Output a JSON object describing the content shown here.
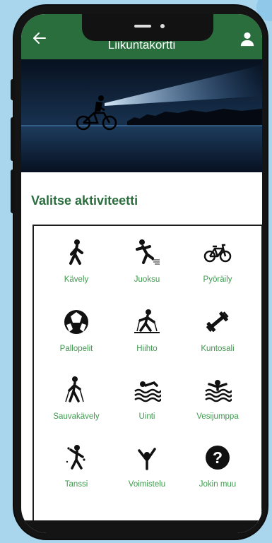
{
  "header": {
    "title": "Liikuntakortti"
  },
  "section": {
    "title": "Valitse aktiviteetti"
  },
  "activities": [
    {
      "label": "Kävely",
      "icon": "walking-icon"
    },
    {
      "label": "Juoksu",
      "icon": "running-icon"
    },
    {
      "label": "Pyöräily",
      "icon": "bicycle-icon"
    },
    {
      "label": "Pallopelit",
      "icon": "ball-games-icon"
    },
    {
      "label": "Hiihto",
      "icon": "skiing-icon"
    },
    {
      "label": "Kuntosali",
      "icon": "dumbbell-icon"
    },
    {
      "label": "Sauvakävely",
      "icon": "nordic-walking-icon"
    },
    {
      "label": "Uinti",
      "icon": "swimming-icon"
    },
    {
      "label": "Vesijumppa",
      "icon": "water-aerobics-icon"
    },
    {
      "label": "Tanssi",
      "icon": "dance-icon"
    },
    {
      "label": "Voimistelu",
      "icon": "gymnastics-icon"
    },
    {
      "label": "Jokin muu",
      "icon": "question-mark-icon"
    }
  ],
  "colors": {
    "header": "#2b6e3e",
    "accent": "#3f9a4f",
    "background": "#a9d6ec"
  }
}
